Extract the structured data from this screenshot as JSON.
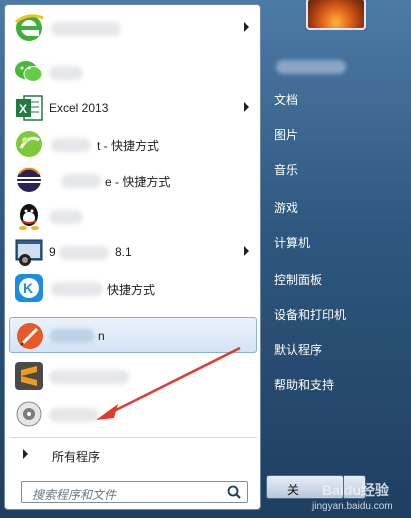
{
  "left": {
    "items": [
      {
        "label": "",
        "has_arrow": true
      },
      {
        "label": "",
        "has_arrow": false
      },
      {
        "label": "Excel 2013",
        "has_arrow": true
      },
      {
        "label": "t - 快捷方式",
        "has_arrow": false
      },
      {
        "label": "e - 快捷方式",
        "has_arrow": false
      },
      {
        "label": "",
        "has_arrow": false
      },
      {
        "label": "8.1",
        "has_arrow": true
      },
      {
        "label": "快捷方式",
        "has_arrow": false
      },
      {
        "label": "n",
        "has_arrow": false
      },
      {
        "label": "",
        "has_arrow": false
      },
      {
        "label": "",
        "has_arrow": false
      }
    ],
    "all_programs": "所有程序",
    "search_placeholder": "搜索程序和文件"
  },
  "right": {
    "items": [
      "文档",
      "图片",
      "音乐",
      "游戏",
      "计算机",
      "控制面板",
      "设备和打印机",
      "默认程序",
      "帮助和支持"
    ]
  },
  "shutdown": {
    "label": "关"
  },
  "watermark": {
    "brand": "Baidu经验",
    "url": "jingyan.baidu.com"
  },
  "colors": {
    "highlight": "#d3e4f6",
    "arrow": "#e23b2e"
  }
}
